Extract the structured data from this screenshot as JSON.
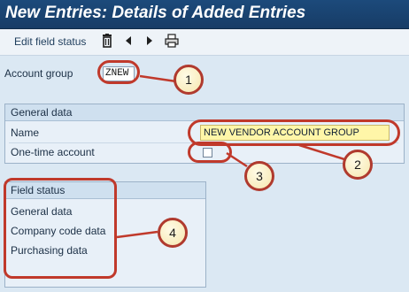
{
  "window": {
    "title": "New Entries: Details of Added Entries"
  },
  "toolbar": {
    "edit_field_status_label": "Edit field status",
    "icons": [
      "trash-icon",
      "previous-icon",
      "next-icon",
      "print-icon"
    ]
  },
  "account_group": {
    "label": "Account group",
    "value": "ZNEW"
  },
  "general_data": {
    "title": "General data",
    "name_label": "Name",
    "name_value": "NEW VENDOR ACCOUNT GROUP",
    "one_time_label": "One-time account",
    "one_time_checked": false
  },
  "field_status": {
    "title": "Field status",
    "items": [
      "General data",
      "Company code data",
      "Purchasing data"
    ]
  },
  "callouts": [
    "1",
    "2",
    "3",
    "4"
  ],
  "colors": {
    "annotation": "#c0392b",
    "title_bar": "#1c4a7b",
    "highlight_field": "#fff6a8"
  }
}
